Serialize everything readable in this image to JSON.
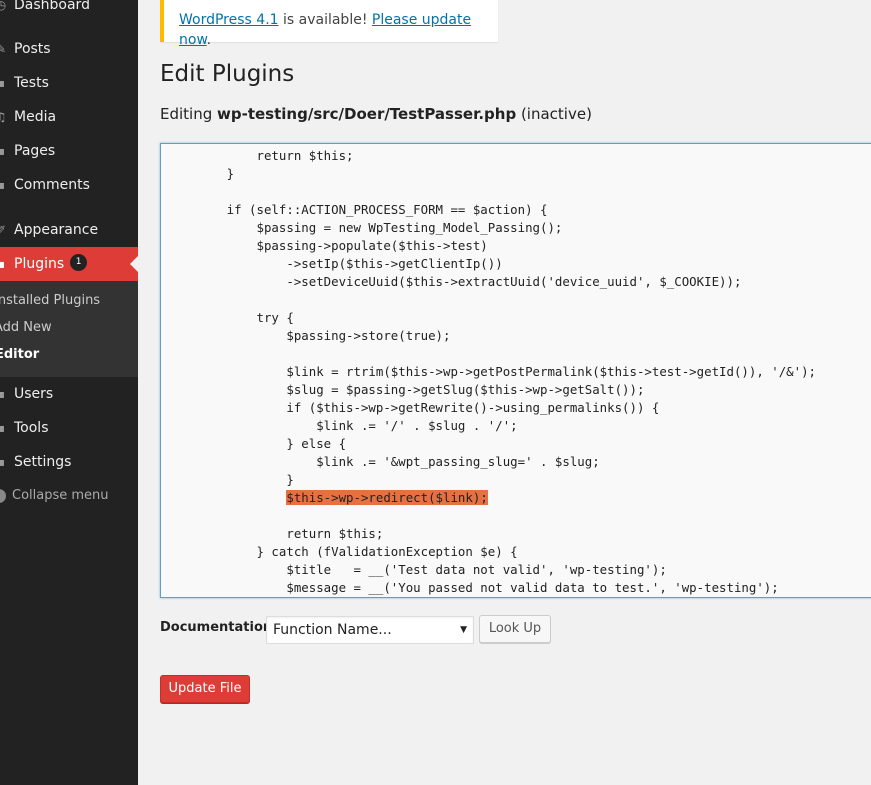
{
  "sidebar": {
    "items": [
      {
        "label": "Dashboard",
        "icon": "dashboard-icon"
      },
      {
        "label": "Posts",
        "icon": "pushpin-icon"
      },
      {
        "label": "Tests",
        "icon": "tests-icon"
      },
      {
        "label": "Media",
        "icon": "media-icon"
      },
      {
        "label": "Pages",
        "icon": "pages-icon"
      },
      {
        "label": "Comments",
        "icon": "comments-icon"
      },
      {
        "label": "Appearance",
        "icon": "brush-icon"
      },
      {
        "label": "Plugins",
        "icon": "plugin-icon",
        "badge": "1"
      },
      {
        "label": "Users",
        "icon": "users-icon"
      },
      {
        "label": "Tools",
        "icon": "tools-icon"
      },
      {
        "label": "Settings",
        "icon": "settings-icon"
      }
    ],
    "submenu": [
      "Installed Plugins",
      "Add New",
      "Editor"
    ],
    "collapse_label": "Collapse menu"
  },
  "notice": {
    "version_link": "WordPress 4.1",
    "middle_text": " is available! ",
    "update_link": "Please update now",
    "end_text": "."
  },
  "page": {
    "title": "Edit Plugins",
    "editing_prefix": "Editing ",
    "file": "wp-testing/src/Doer/TestPasser.php",
    "status": " (inactive)"
  },
  "editor": {
    "lines": [
      "            return $this;",
      "        }",
      "",
      "        if (self::ACTION_PROCESS_FORM == $action) {",
      "            $passing = new WpTesting_Model_Passing();",
      "            $passing->populate($this->test)",
      "                ->setIp($this->getClientIp())",
      "                ->setDeviceUuid($this->extractUuid('device_uuid', $_COOKIE));",
      "",
      "            try {",
      "                $passing->store(true);",
      "",
      "                $link = rtrim($this->wp->getPostPermalink($this->test->getId()), '/&');",
      "                $slug = $passing->getSlug($this->wp->getSalt());",
      "                if ($this->wp->getRewrite()->using_permalinks()) {",
      "                    $link .= '/' . $slug . '/';",
      "                } else {",
      "                    $link .= '&wpt_passing_slug=' . $slug;",
      "                }",
      "                $this->wp->redirect($link);",
      "",
      "                return $this;",
      "            } catch (fValidationException $e) {",
      "                $title   = __('Test data not valid', 'wp-testing');",
      "                $message = __('You passed not valid data to test.', 'wp-testing');"
    ],
    "highlight_line": 19
  },
  "documentation": {
    "label": "Documentation:",
    "selected": "Function Name...",
    "lookup_button": "Look Up"
  },
  "update_button": "Update File",
  "colors": {
    "sidebar_bg": "#222222",
    "active_menu": "#dd3d36",
    "link": "#0073aa",
    "highlight": "#e57142",
    "notice_border": "#ffba00"
  }
}
